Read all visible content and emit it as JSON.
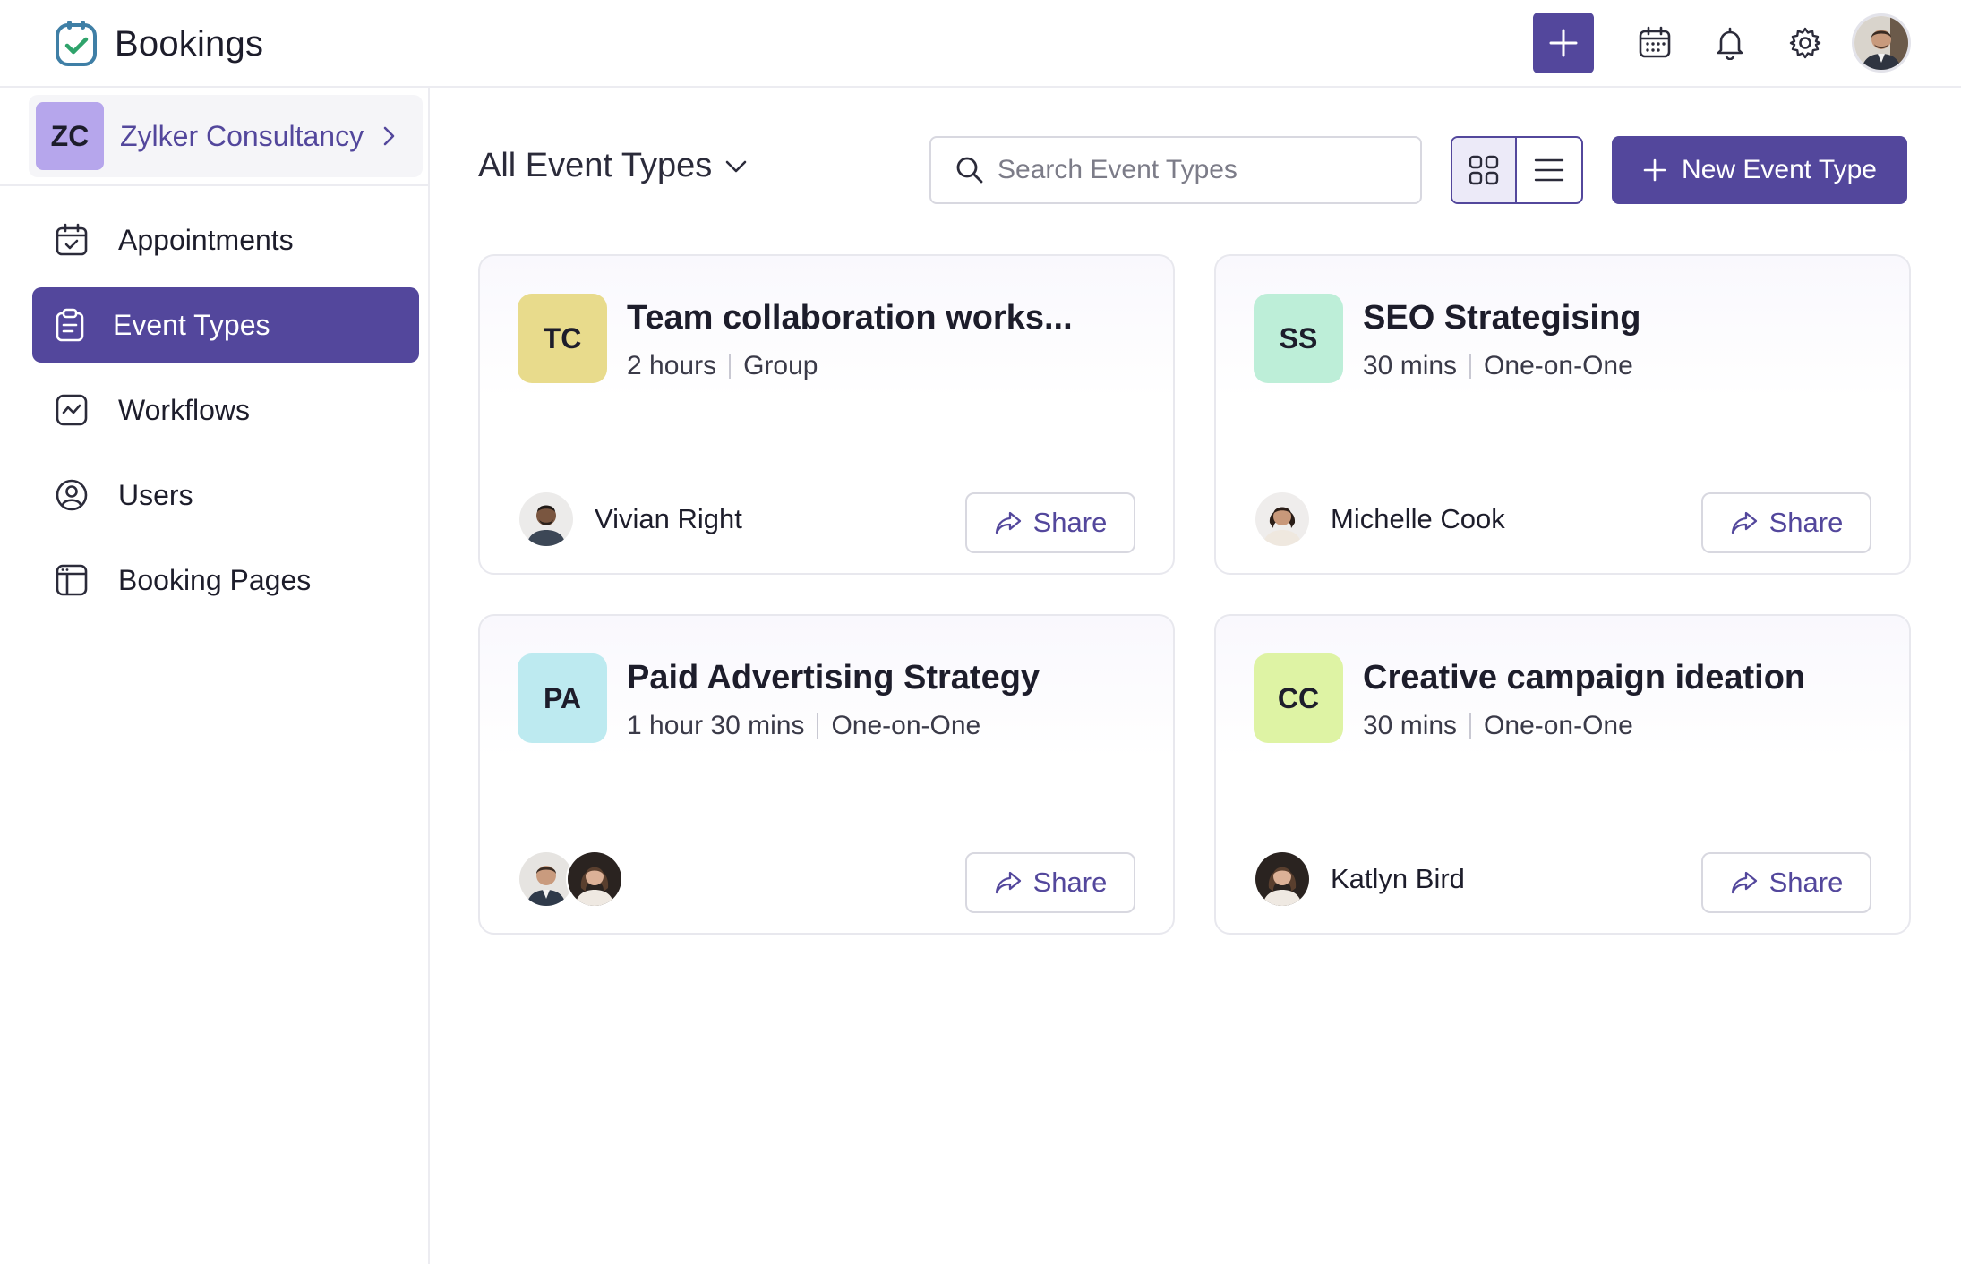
{
  "app": {
    "title": "Bookings",
    "icons": {
      "logo": "bookings-logo-icon",
      "add": "plus-icon",
      "calendar": "calendar-icon",
      "notifications": "bell-icon",
      "settings": "gear-icon"
    },
    "accent_color": "#53479c"
  },
  "sidebar": {
    "org": {
      "initials": "ZC",
      "name": "Zylker Consultancy",
      "badge_color": "#b6a6ec"
    },
    "items": [
      {
        "label": "Appointments",
        "icon": "calendar-check-icon",
        "active": false
      },
      {
        "label": "Event Types",
        "icon": "clipboard-icon",
        "active": true
      },
      {
        "label": "Workflows",
        "icon": "workflow-icon",
        "active": false
      },
      {
        "label": "Users",
        "icon": "user-circle-icon",
        "active": false
      },
      {
        "label": "Booking Pages",
        "icon": "booking-page-icon",
        "active": false
      }
    ]
  },
  "main": {
    "filter_label": "All Event Types",
    "search": {
      "placeholder": "Search Event Types",
      "value": ""
    },
    "view_mode": "grid",
    "new_button_label": "New Event Type",
    "share_label": "Share",
    "cards": [
      {
        "initials": "TC",
        "badge_color": "#e8db8c",
        "title": "Team collaboration works...",
        "duration": "2 hours",
        "type": "Group",
        "host": "Vivian Right"
      },
      {
        "initials": "SS",
        "badge_color": "#bdeed8",
        "title": "SEO Strategising",
        "duration": "30 mins",
        "type": "One-on-One",
        "host": "Michelle Cook"
      },
      {
        "initials": "PA",
        "badge_color": "#bdeaf0",
        "title": "Paid Advertising Strategy",
        "duration": "1 hour 30 mins",
        "type": "One-on-One",
        "host": ""
      },
      {
        "initials": "CC",
        "badge_color": "#def3a4",
        "title": "Creative campaign ideation",
        "duration": "30 mins",
        "type": "One-on-One",
        "host": "Katlyn Bird"
      }
    ]
  }
}
